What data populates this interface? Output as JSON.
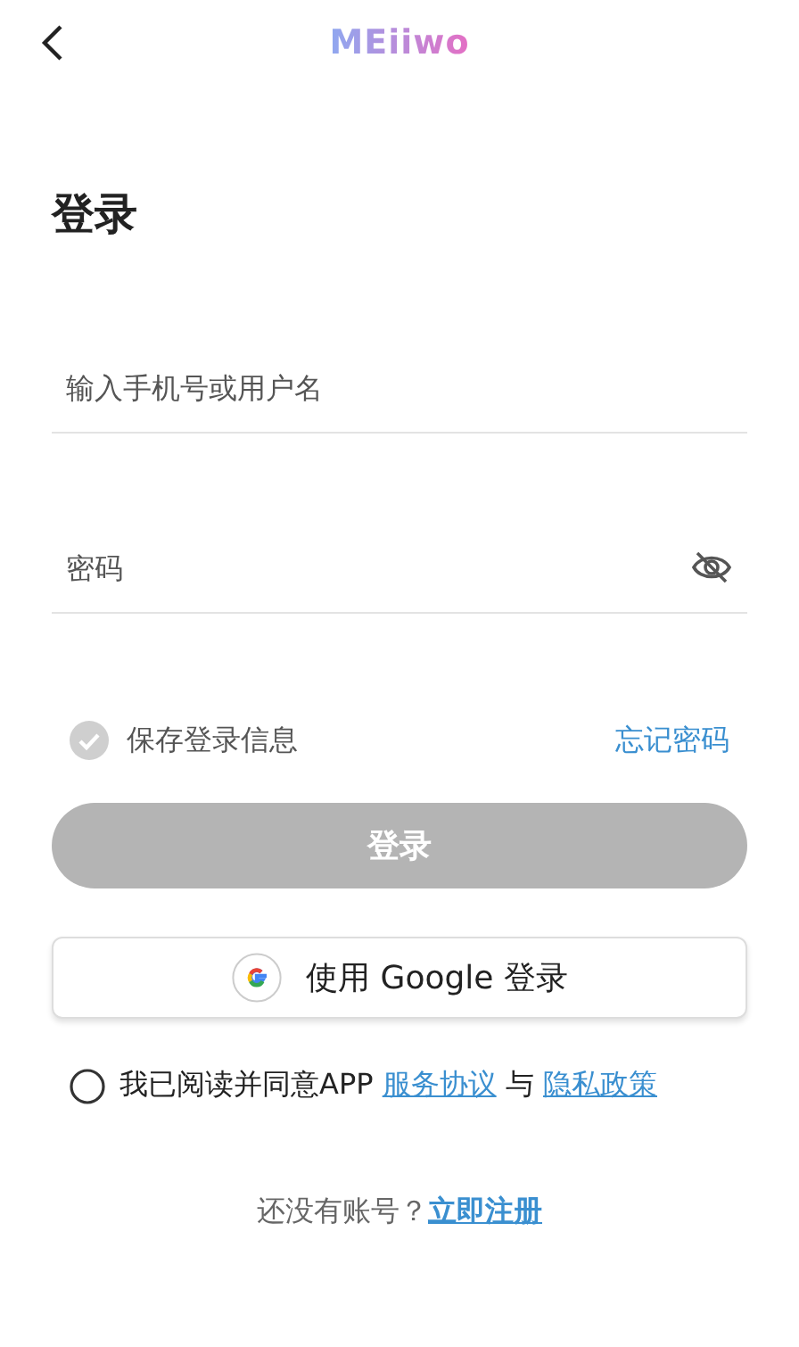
{
  "header": {
    "logo": "MEiiwo"
  },
  "title": "登录",
  "fields": [
    {
      "kind": "text",
      "placeholder": "输入手机号或用户名"
    },
    {
      "kind": "password",
      "placeholder": "密码",
      "reveal": false
    }
  ],
  "remember": {
    "label": "保存登录信息",
    "checked": false
  },
  "forgot": "忘记密码",
  "login_button": {
    "label": "登录",
    "disabled": true
  },
  "google_button": {
    "label": "使用 Google 登录"
  },
  "agreement": {
    "checked": false,
    "parts": [
      {
        "kind": "text",
        "text": "我已阅读并同意APP "
      },
      {
        "kind": "link",
        "text": "服务协议"
      },
      {
        "kind": "text",
        "text": " 与 "
      },
      {
        "kind": "link",
        "text": "隐私政策"
      }
    ]
  },
  "signup": {
    "prompt": "还没有账号？",
    "link": "立即注册"
  }
}
